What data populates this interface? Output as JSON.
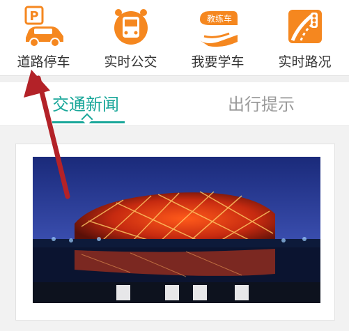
{
  "quick_menu": [
    {
      "label": "道路停车",
      "icon": "parking-car-icon"
    },
    {
      "label": "实时公交",
      "icon": "bus-icon"
    },
    {
      "label": "我要学车",
      "icon": "driving-school-car-icon"
    },
    {
      "label": "实时路况",
      "icon": "traffic-road-icon"
    }
  ],
  "driving_school_badge": "教练车",
  "parking_badge": "P",
  "tabs": [
    {
      "label": "交通新闻",
      "active": true
    },
    {
      "label": "出行提示",
      "active": false
    }
  ],
  "colors": {
    "accent": "#1aa79a",
    "icon_orange": "#f5871f",
    "inactive_tab": "#9a9a9a",
    "arrow": "#b32228"
  }
}
